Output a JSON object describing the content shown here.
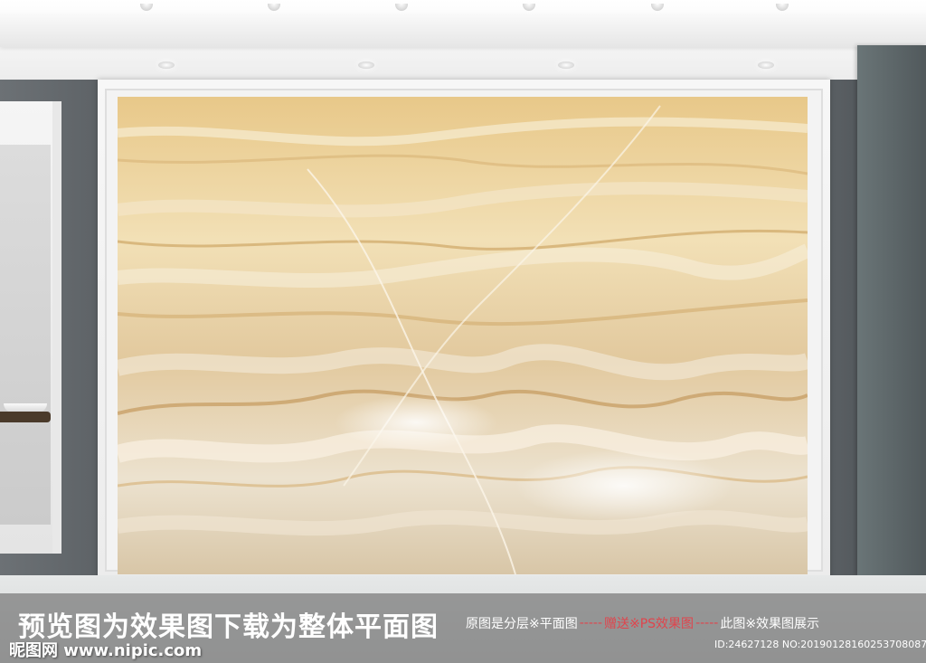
{
  "banner": {
    "main_text": "预览图为效果图下载为整体平面图",
    "note_left": "原图是分层※平面图",
    "dashes_1": "-----",
    "note_gift": "赠送※PS效果图",
    "dashes_2": "-----",
    "note_right": "此图※效果图展示"
  },
  "watermark": {
    "text": "昵图网 www.nipic.com"
  },
  "image_id": {
    "text": "ID:24627128 NO:20190128160253708087"
  },
  "colors": {
    "onyx_base": "#e4c995",
    "onyx_vein": "#c9a06a",
    "frame": "#f3f3f3",
    "wall": "#5e6367",
    "banner_accent": "#e0444c"
  }
}
